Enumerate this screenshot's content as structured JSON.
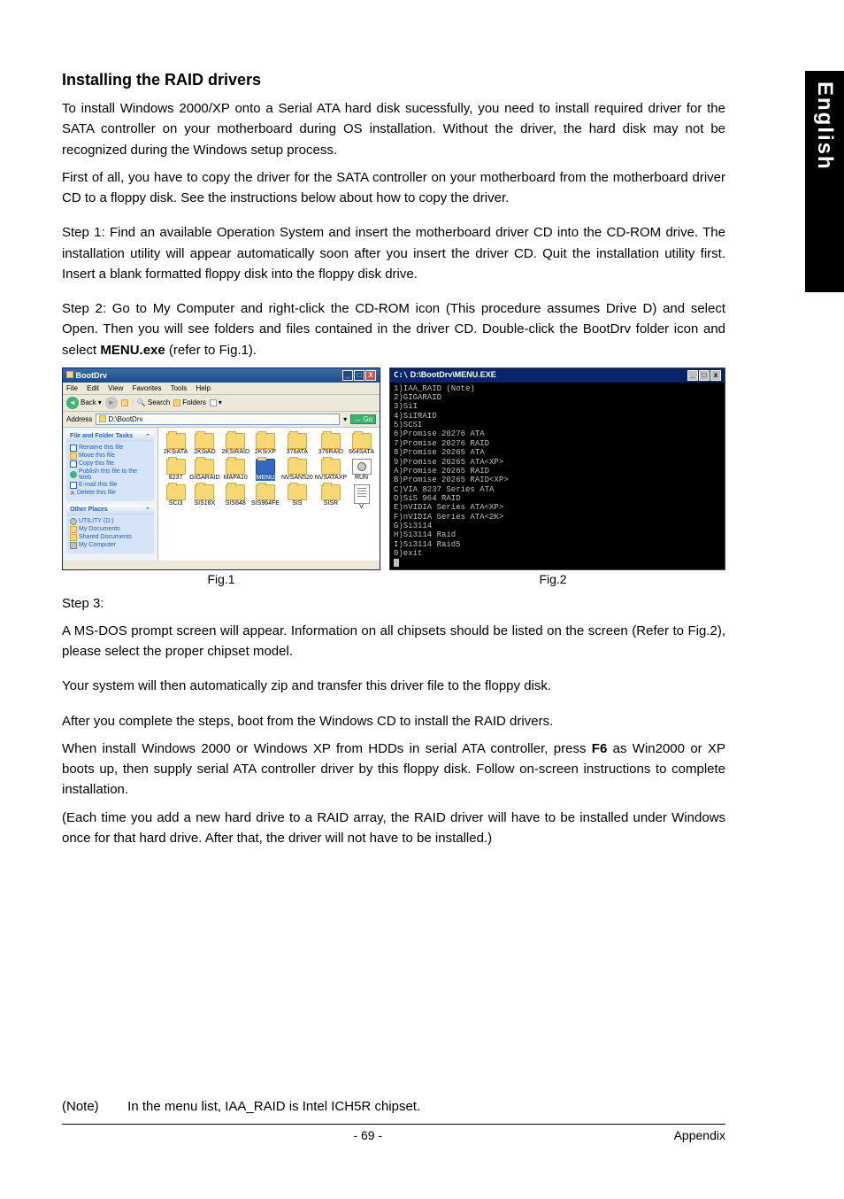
{
  "sideTab": "English",
  "heading": "Installing the RAID drivers",
  "para1": "To install Windows 2000/XP onto a Serial ATA hard disk sucessfully, you need to install  required driver for the SATA controller on your motherboard during OS installation. Without the driver, the hard disk may not be recognized during the Windows setup process.",
  "para2": "First of all, you have to copy the driver for the SATA controller on your motherboard from the motherboard driver CD to a floppy disk. See the instructions below about how to copy the driver.",
  "step1": "Step 1: Find an available Operation System and insert the motherboard driver CD into the CD-ROM drive. The installation utility will appear automatically soon after you insert the driver CD. Quit the installation utility first. Insert a blank formatted floppy disk into the floppy disk drive.",
  "step2a": "Step 2: Go to My Computer and right-click the CD-ROM icon (This procedure assumes Drive D) and select Open. Then you will see  folders and files contained in the driver CD. Double-click the BootDrv folder icon and select  ",
  "step2b": "MENU.exe",
  "step2c": " (refer to Fig.1).",
  "explorer": {
    "title": "BootDrv",
    "menu": [
      "File",
      "Edit",
      "View",
      "Favorites",
      "Tools",
      "Help"
    ],
    "back": "Back",
    "search": "Search",
    "foldersBtn": "Folders",
    "addrLabel": "Address",
    "addrValue": "D:\\BootDrv",
    "go": "Go",
    "tasksHdr": "File and Folder Tasks",
    "tasks": [
      "Rename this file",
      "Move this file",
      "Copy this file",
      "Publish this file to the Web",
      "E-mail this file",
      "Delete this file"
    ],
    "placesHdr": "Other Places",
    "places": [
      "UTILITY (D:)",
      "My Documents",
      "Shared Documents",
      "My Computer"
    ],
    "folders": [
      "2KSiATA",
      "2KSiAD",
      "2KSiRAID",
      "2KSiXP",
      "376ATA",
      "376RAID",
      "664SATA",
      "8237",
      "GIGARAID",
      "MAPA10",
      "MENU",
      "NVSAN520",
      "NVSATAXP",
      "RUN",
      "SCI3",
      "SIS18X",
      "SIS648",
      "SIS964FE",
      "SIS",
      "SISR",
      "V"
    ]
  },
  "dos": {
    "title": "D:\\BootDrv\\MENU.EXE",
    "lines": [
      "1)IAA_RAID (Note)",
      "2)GIGARAID",
      "3)SiI",
      "4)SiIRAID",
      "5)SCSI",
      "6)Promise 20276 ATA",
      "7)Promise 20276 RAID",
      "8)Promise 20265 ATA",
      "9)Promise 20265 ATA<XP>",
      "A)Promise 20265 RAID",
      "B)Promise 20265 RAID<XP>",
      "C)VIA 8237 Series ATA",
      "D)SiS 964 RAID",
      "E)nVIDIA Series ATA<XP>",
      "F)nVIDIA Series ATA<2K>",
      "G)Si3114",
      "H)Si3114 Raid",
      "I)Si3114 Raid5",
      "0)exit"
    ]
  },
  "figCap1": "Fig.1",
  "figCap2": "Fig.2",
  "step3hdr": "Step 3:",
  "step3a": "A MS-DOS prompt screen will appear. Information on all chipsets should be listed on the screen (Refer to Fig.2), please select the proper chipset model.",
  "step3b": "Your system will then automatically zip and transfer this driver file to the floppy disk.",
  "after1": "After you complete the steps, boot from the Windows CD to install the RAID drivers.",
  "after2a": "When install Windows 2000 or Windows XP from HDDs in serial ATA controller, press ",
  "after2b": "F6",
  "after2c": " as Win2000 or XP boots up, then supply serial ATA controller driver by this floppy disk. Follow on-screen instructions to complete installation.",
  "after3": "(Each time you add a new hard drive to a RAID array, the RAID driver will have to be installed under Windows once for that hard drive. After that, the driver will not have to be installed.)",
  "noteLabel": "(Note)",
  "noteText": "In the menu list, IAA_RAID is Intel ICH5R chipset.",
  "pageNum": "- 69 -",
  "pageSection": "Appendix"
}
